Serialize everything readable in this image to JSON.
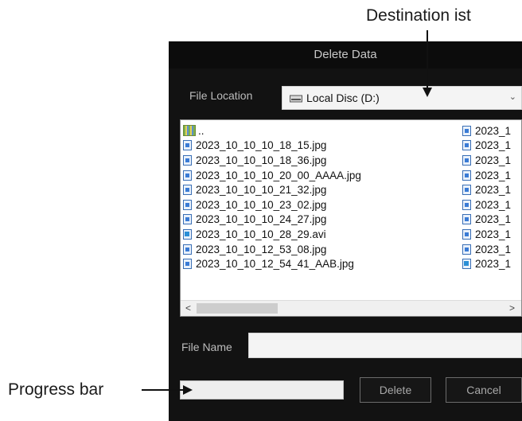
{
  "callouts": {
    "destination_list": "Destination ist",
    "progress_bar": "Progress bar"
  },
  "dialog": {
    "title": "Delete Data",
    "file_location_label": "File Location",
    "drive_icon": "drive-icon",
    "location_value": "Local Disc (D:)",
    "file_name_label": "File Name",
    "file_name_value": "",
    "progress": 0,
    "delete_label": "Delete",
    "cancel_label": "Cancel"
  },
  "files_left": [
    {
      "name": "..",
      "icon": "folder-up-icon"
    },
    {
      "name": "2023_10_10_10_18_15.jpg",
      "icon": "image-file-icon"
    },
    {
      "name": "2023_10_10_10_18_36.jpg",
      "icon": "image-file-icon"
    },
    {
      "name": "2023_10_10_10_20_00_AAAA.jpg",
      "icon": "image-file-icon"
    },
    {
      "name": "2023_10_10_10_21_32.jpg",
      "icon": "image-file-icon"
    },
    {
      "name": "2023_10_10_10_23_02.jpg",
      "icon": "image-file-icon"
    },
    {
      "name": "2023_10_10_10_24_27.jpg",
      "icon": "image-file-icon"
    },
    {
      "name": "2023_10_10_10_28_29.avi",
      "icon": "video-file-icon"
    },
    {
      "name": "2023_10_10_12_53_08.jpg",
      "icon": "image-file-icon"
    },
    {
      "name": "2023_10_10_12_54_41_AAB.jpg",
      "icon": "image-file-icon"
    }
  ],
  "files_right": [
    {
      "name": "2023_1",
      "icon": "image-file-icon"
    },
    {
      "name": "2023_1",
      "icon": "image-file-icon"
    },
    {
      "name": "2023_1",
      "icon": "image-file-icon"
    },
    {
      "name": "2023_1",
      "icon": "image-file-icon"
    },
    {
      "name": "2023_1",
      "icon": "image-file-icon"
    },
    {
      "name": "2023_1",
      "icon": "image-file-icon"
    },
    {
      "name": "2023_1",
      "icon": "image-file-icon"
    },
    {
      "name": "2023_1",
      "icon": "image-file-icon"
    },
    {
      "name": "2023_1",
      "icon": "image-file-icon"
    },
    {
      "name": "2023_1",
      "icon": "video-file-icon"
    }
  ],
  "scrollbar": {
    "left_arrow": "<",
    "right_arrow": ">"
  },
  "combo_chevron": "⌄"
}
